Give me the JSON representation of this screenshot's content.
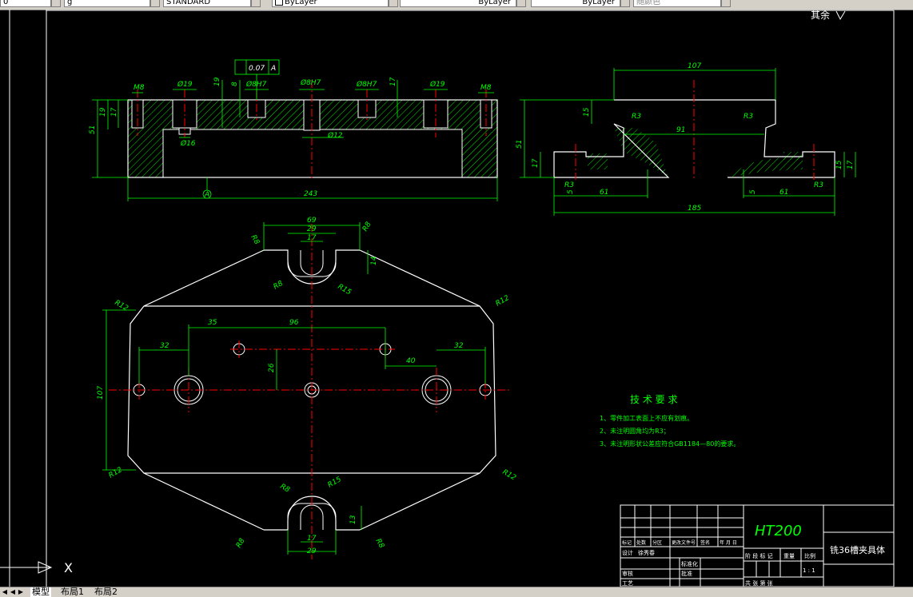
{
  "toolbar": {
    "layer_field": "0",
    "linetype_field": "g",
    "textstyle_field": "STANDARD",
    "color_field": "ByLayer",
    "linetype2_field": "ByLayer",
    "lineweight_field": "ByLayer",
    "plotstyle_field": "随颜色"
  },
  "drawing": {
    "surface_mark": "其余",
    "front_view": {
      "tolerance_value": "0.07",
      "tolerance_datum": "A",
      "dims": {
        "m8_left": "M8",
        "d19_left": "Ø19",
        "d19_depth": "19",
        "h8": "8",
        "d8h7_1": "Ø8H7",
        "d8h7_center": "Ø8H7",
        "d8h7_3": "Ø8H7",
        "d19_right": "Ø19",
        "m8_right": "M8",
        "h17_r": "17",
        "h51": "51",
        "h19": "19",
        "h17": "17",
        "d16": "Ø16",
        "d12": "Ø12",
        "w243": "243",
        "datum": "A"
      }
    },
    "side_view": {
      "dims": {
        "w107": "107",
        "r3_a": "R3",
        "r3_b": "R3",
        "h15": "15",
        "w91": "91",
        "h51": "51",
        "h17": "17",
        "r3_c": "R3",
        "r3_d": "R3",
        "w61_l": "61",
        "w61_r": "61",
        "w5_l": "5",
        "w5_r": "5",
        "w185": "185",
        "h15_r": "15",
        "h17_r": "17"
      }
    },
    "top_view": {
      "dims": {
        "w69": "69",
        "w29_top": "29",
        "w17_top": "17",
        "r8_tl": "R8",
        "r8_tr": "R8",
        "h14": "14",
        "r8_slot": "R8",
        "r15_slot": "R15",
        "r12_tl": "R12",
        "r12_tr": "R12",
        "r12_bl": "R12",
        "r12_br": "R12",
        "w35": "35",
        "w96": "96",
        "w32_l": "32",
        "w32_r": "32",
        "w40": "40",
        "h26": "26",
        "h107": "107",
        "r8_slot_b": "R8",
        "r15_slot_b": "R15",
        "h13": "13",
        "w17_bot": "17",
        "w29_bot": "29",
        "r8_bl": "R8",
        "r8_br": "R8"
      }
    },
    "tech_req": {
      "title": "技 术 要 求",
      "items": [
        "1、零件加工表面上不应有划痕。",
        "2、未注明圆角均为R3；",
        "3、未注明形状公差应符合GB1184—80的要求。"
      ]
    },
    "title_block": {
      "material": "HT200",
      "part_name": "铣36槽夹具体",
      "headers": [
        "标记",
        "处数",
        "分区",
        "更改文件号",
        "签名",
        "年 月 日"
      ],
      "row_labels": [
        "设计",
        "审核",
        "工艺"
      ],
      "designer": "徐秀春",
      "std_label": "标准化",
      "approve_label": "批准",
      "stage_headers": [
        "阶 段 标 记",
        "重量",
        "比例"
      ],
      "scale": "1 : 1",
      "sheet_text": "共   张  第   张",
      "right_labels": [
        "标准化",
        "批准"
      ]
    },
    "ucs": {
      "x_label": "X"
    }
  },
  "tabs": {
    "model": "模型",
    "layout1": "布局1",
    "layout2": "布局2"
  },
  "colors": {
    "background": "#000000",
    "outline": "#ffffff",
    "dimension": "#00ff00",
    "centerline": "#ff0000",
    "hatch": "#00ff00"
  }
}
